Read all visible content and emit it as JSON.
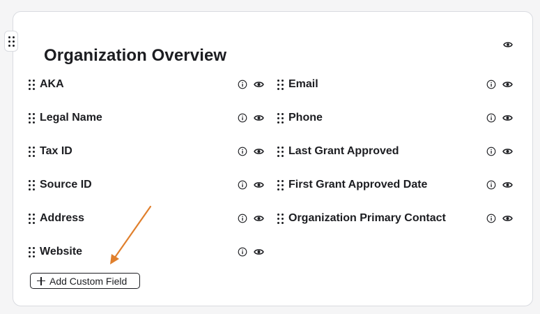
{
  "card": {
    "title": "Organization Overview",
    "title_visibility_icon": "eye-icon",
    "drag_handle_icon": "grip-dots-icon"
  },
  "fields_left": [
    {
      "label": "AKA",
      "info_icon": "info-icon",
      "visibility_icon": "eye-icon"
    },
    {
      "label": "Legal Name",
      "info_icon": "info-icon",
      "visibility_icon": "eye-icon"
    },
    {
      "label": "Tax ID",
      "info_icon": "info-icon",
      "visibility_icon": "eye-icon"
    },
    {
      "label": "Source ID",
      "info_icon": "info-icon",
      "visibility_icon": "eye-icon"
    },
    {
      "label": "Address",
      "info_icon": "info-icon",
      "visibility_icon": "eye-icon"
    },
    {
      "label": "Website",
      "info_icon": "info-icon",
      "visibility_icon": "eye-icon"
    }
  ],
  "fields_right": [
    {
      "label": "Email",
      "info_icon": "info-icon",
      "visibility_icon": "eye-icon"
    },
    {
      "label": "Phone",
      "info_icon": "info-icon",
      "visibility_icon": "eye-icon"
    },
    {
      "label": "Last Grant Approved",
      "info_icon": "info-icon",
      "visibility_icon": "eye-icon"
    },
    {
      "label": "First Grant Approved Date",
      "info_icon": "info-icon",
      "visibility_icon": "eye-icon"
    },
    {
      "label": "Organization Primary Contact",
      "info_icon": "info-icon",
      "visibility_icon": "eye-icon"
    }
  ],
  "add_custom_field": {
    "label": "Add Custom Field",
    "icon": "plus-icon"
  },
  "annotation": {
    "arrow_color": "#e07f2c",
    "icon": "arrow-annotation"
  },
  "colors": {
    "text": "#1c1d21",
    "border": "#d9dbe0",
    "background": "#f5f5f6",
    "card": "#ffffff"
  }
}
